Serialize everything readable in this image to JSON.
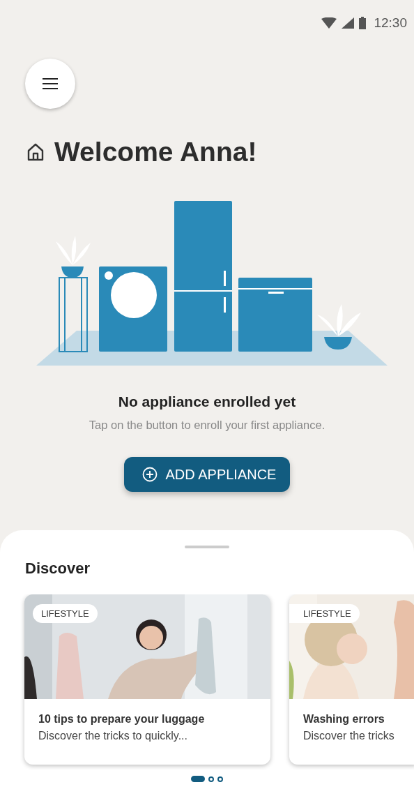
{
  "status_bar": {
    "time": "12:30"
  },
  "greeting": "Welcome Anna!",
  "empty_state": {
    "title": "No appliance enrolled yet",
    "message": "Tap on the button to enroll your first appliance.",
    "button": "ADD APPLIANCE"
  },
  "discover": {
    "title": "Discover",
    "cards": [
      {
        "tag": "LIFESTYLE",
        "title": "10 tips to prepare your luggage",
        "description": "Discover the tricks to quickly..."
      },
      {
        "tag": "LIFESTYLE",
        "title": "Washing errors",
        "description": "Discover the tricks"
      }
    ],
    "pages": [
      {
        "selected": true
      },
      {
        "selected": false
      },
      {
        "selected": false
      }
    ]
  }
}
